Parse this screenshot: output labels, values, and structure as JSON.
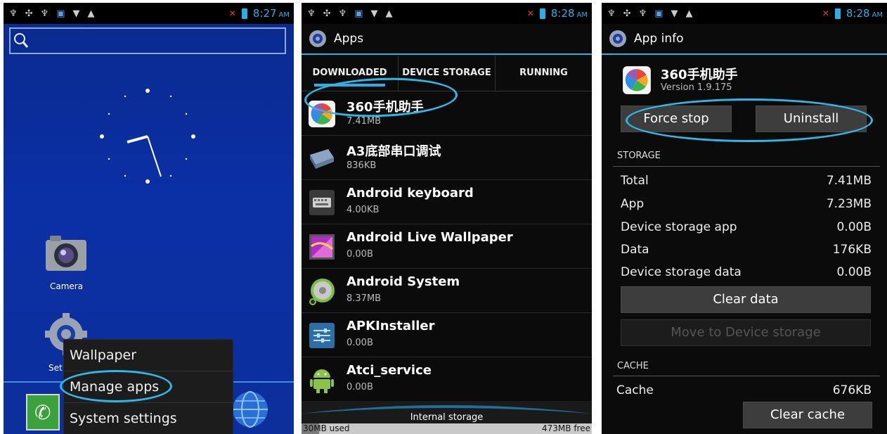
{
  "status_bars": [
    {
      "time": "8:27",
      "ampm": "AM"
    },
    {
      "time": "8:28",
      "ampm": "AM"
    },
    {
      "time": "8:28",
      "ampm": "AM"
    }
  ],
  "home": {
    "desktop_icons": [
      {
        "label": "Camera",
        "icon": "camera-icon"
      },
      {
        "label": "Set",
        "icon": "settings-gear-icon"
      }
    ],
    "context_menu": [
      "Wallpaper",
      "Manage apps",
      "System settings"
    ]
  },
  "apps_screen": {
    "title": "Apps",
    "tabs": [
      "DOWNLOADED",
      "DEVICE STORAGE",
      "RUNNING"
    ],
    "apps": [
      {
        "name": "360手机助手",
        "size": "7.41MB",
        "icon": "app-360-icon"
      },
      {
        "name": "A3底部串口调试",
        "size": "836KB",
        "icon": "serial-port-icon"
      },
      {
        "name": "Android keyboard",
        "size": "4.00KB",
        "icon": "keyboard-icon"
      },
      {
        "name": "Android Live Wallpaper",
        "size": "0.00B",
        "icon": "live-wallpaper-icon"
      },
      {
        "name": "Android System",
        "size": "8.37MB",
        "icon": "android-system-icon"
      },
      {
        "name": "APKInstaller",
        "size": "0.00B",
        "icon": "apk-installer-icon"
      },
      {
        "name": "Atci_service",
        "size": "0.00B",
        "icon": "android-robot-icon"
      }
    ],
    "storage": {
      "label": "Internal storage",
      "used": "30MB used",
      "free": "473MB free",
      "used_fraction": 0.06
    }
  },
  "app_info": {
    "title": "App info",
    "app_name": "360手机助手",
    "version": "Version 1.9.175",
    "buttons": {
      "force_stop": "Force stop",
      "uninstall": "Uninstall",
      "clear_data": "Clear data",
      "move": "Move to Device storage",
      "clear_cache": "Clear cache"
    },
    "storage_header": "STORAGE",
    "storage_rows": [
      {
        "label": "Total",
        "value": "7.41MB"
      },
      {
        "label": "App",
        "value": "7.23MB"
      },
      {
        "label": "Device storage app",
        "value": "0.00B"
      },
      {
        "label": "Data",
        "value": "176KB"
      },
      {
        "label": "Device storage data",
        "value": "0.00B"
      }
    ],
    "cache_header": "CACHE",
    "cache_row": {
      "label": "Cache",
      "value": "676KB"
    }
  },
  "colors": {
    "accent": "#2aaee6",
    "highlight_ring": "#2fb7e6",
    "home_bg": "#0b2fa5"
  }
}
